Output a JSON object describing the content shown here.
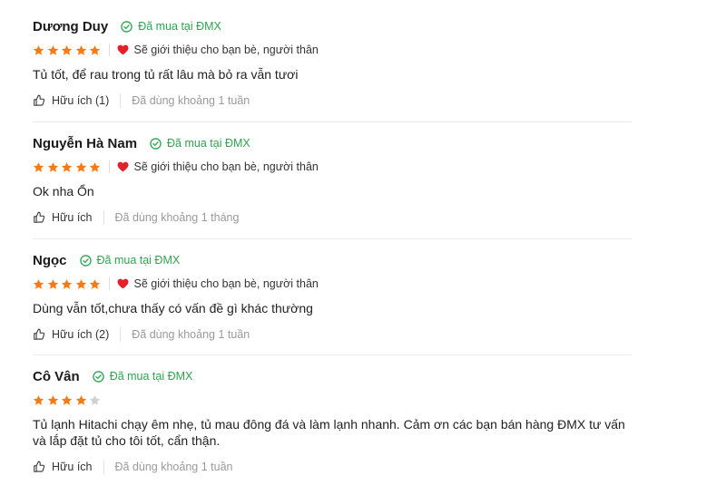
{
  "colors": {
    "star_active": "#fb7a14",
    "star_inactive": "#d0d0d0",
    "verified_green": "#2ea44f",
    "heart_red": "#e4202a",
    "muted_text": "#9a9a9a"
  },
  "reviews": [
    {
      "name": "Dương Duy",
      "verified": "Đã mua tại ĐMX",
      "rating": 5,
      "recommend": "Sẽ giới thiệu cho bạn bè, người thân",
      "comment": "Tủ tốt, để rau trong tủ rất lâu mà bỏ ra vẫn tươi",
      "helpful": "Hữu ích (1)",
      "usage": "Đã dùng khoảng 1 tuần"
    },
    {
      "name": "Nguyễn Hà Nam",
      "verified": "Đã mua tại ĐMX",
      "rating": 5,
      "recommend": "Sẽ giới thiệu cho bạn bè, người thân",
      "comment": "Ok nha Ổn",
      "helpful": "Hữu ích",
      "usage": "Đã dùng khoảng 1 tháng"
    },
    {
      "name": "Ngọc",
      "verified": "Đã mua tại ĐMX",
      "rating": 5,
      "recommend": "Sẽ giới thiệu cho bạn bè, người thân",
      "comment": "Dùng vẫn tốt,chưa thấy có vấn đề gì khác thường",
      "helpful": "Hữu ích (2)",
      "usage": "Đã dùng khoảng 1 tuần"
    },
    {
      "name": "Cô Vân",
      "verified": "Đã mua tại ĐMX",
      "rating": 4,
      "recommend": "",
      "comment": "Tủ lạnh Hitachi chạy êm nhẹ, tủ mau đông đá và làm lạnh nhanh. Cảm ơn các bạn bán hàng ĐMX tư vấn và lắp đặt tủ cho tôi tốt, cẩn thận.",
      "helpful": "Hữu ích",
      "usage": "Đã dùng khoảng 1 tuần"
    }
  ]
}
